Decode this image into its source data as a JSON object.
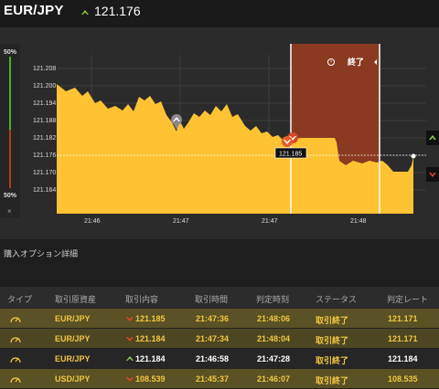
{
  "header": {
    "pair": "EUR/JPY",
    "rate": "121.176",
    "direction_icon": "up-arrow-icon"
  },
  "ratio": {
    "top": "50%",
    "bottom": "50%",
    "close": "×"
  },
  "chart": {
    "y_ticks": [
      "121.208",
      "121.200",
      "121.194",
      "121.188",
      "121.182",
      "121.176",
      "121.170",
      "121.164"
    ],
    "x_ticks": [
      "21:46",
      "21:47",
      "21:47",
      "21:48"
    ],
    "end_label": "終了",
    "marker_label": "121.185",
    "colors": {
      "area": "#ffc233",
      "expiry_zone": "#8b3a22",
      "current_line": "#ffffff"
    }
  },
  "section": {
    "title": "購入オプション詳細"
  },
  "table": {
    "headers": [
      "タイプ",
      "取引原資産",
      "取引内容",
      "取引時間",
      "判定時刻",
      "ステータス",
      "判定レート"
    ],
    "rows": [
      {
        "asset": "EUR/JPY",
        "dir": "down",
        "rate": "121.185",
        "time": "21:47:36",
        "judge": "21:48:06",
        "status": "取引終了",
        "judge_rate": "121.171"
      },
      {
        "asset": "EUR/JPY",
        "dir": "down",
        "rate": "121.184",
        "time": "21:47:34",
        "judge": "21:48:04",
        "status": "取引終了",
        "judge_rate": "121.171"
      },
      {
        "asset": "EUR/JPY",
        "dir": "up",
        "rate": "121.184",
        "time": "21:46:58",
        "judge": "21:47:28",
        "status": "取引終了",
        "judge_rate": "121.184"
      },
      {
        "asset": "USD/JPY",
        "dir": "down",
        "rate": "108.539",
        "time": "21:45:37",
        "judge": "21:46:07",
        "status": "取引終了",
        "judge_rate": "108.535"
      }
    ]
  }
}
